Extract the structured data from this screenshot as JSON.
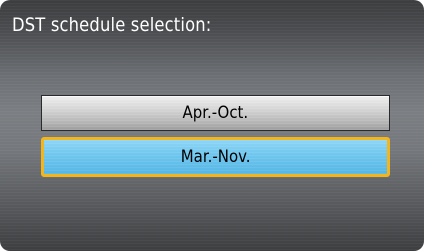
{
  "screen": {
    "title": "DST schedule selection:"
  },
  "options": [
    {
      "label": "Apr.-Oct.",
      "selected": false
    },
    {
      "label": "Mar.-Nov.",
      "selected": true
    }
  ],
  "colors": {
    "selected_fill": "#6ec6ee",
    "selected_border": "#f2b51c",
    "unselected_fill": "#c8c8c8"
  }
}
